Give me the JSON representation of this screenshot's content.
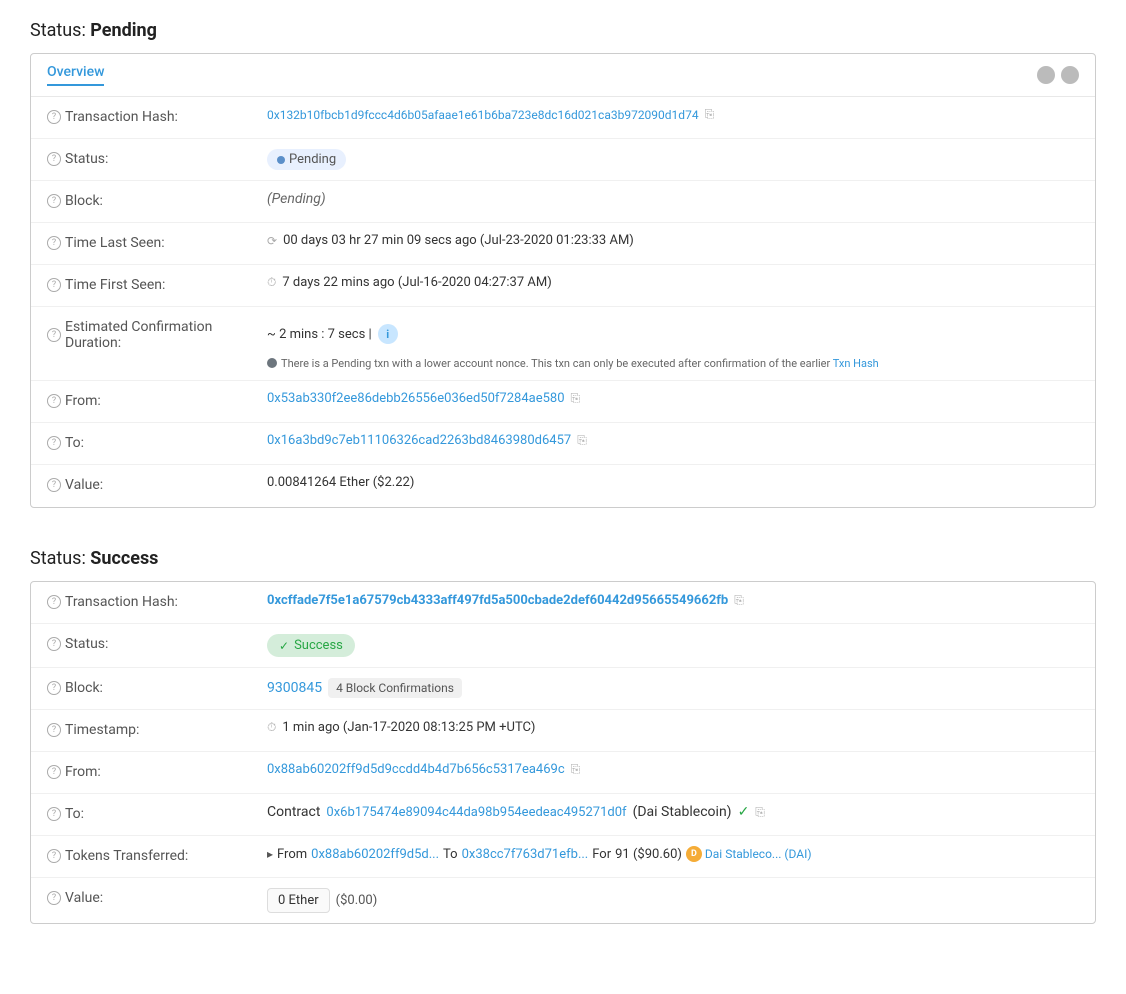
{
  "pending": {
    "section_title": "Status:",
    "section_bold": "Pending",
    "tab_label": "Overview",
    "rows": {
      "transaction_hash_label": "Transaction Hash:",
      "transaction_hash_value": "0x132b10fbcb1d9fccc4d6b05afaae1e61b6ba723e8dc16d021ca3b972090d1d74",
      "status_label": "Status:",
      "status_value": "Pending",
      "block_label": "Block:",
      "block_value": "(Pending)",
      "time_last_seen_label": "Time Last Seen:",
      "time_last_seen_value": "00 days 03 hr 27 min 09 secs ago (Jul-23-2020 01:23:33 AM)",
      "time_first_seen_label": "Time First Seen:",
      "time_first_seen_value": "7 days 22 mins ago (Jul-16-2020 04:27:37 AM)",
      "est_conf_label": "Estimated Confirmation Duration:",
      "est_conf_value": "~ 2 mins : 7 secs |",
      "est_conf_note": "There is a Pending txn with a lower account nonce. This txn can only be executed after confirmation of the earlier Txn Hash",
      "from_label": "From:",
      "from_value": "0x53ab330f2ee86debb26556e036ed50f7284ae580",
      "to_label": "To:",
      "to_value": "0x16a3bd9c7eb11106326cad2263bd8463980d6457",
      "value_label": "Value:",
      "value_value": "0.00841264 Ether ($2.22)"
    }
  },
  "success": {
    "section_title": "Status:",
    "section_bold": "Success",
    "rows": {
      "transaction_hash_label": "Transaction Hash:",
      "transaction_hash_value": "0xcffade7f5e1a67579cb4333aff497fd5a500cbade2def60442d95665549662fb",
      "status_label": "Status:",
      "status_value": "Success",
      "block_label": "Block:",
      "block_number": "9300845",
      "block_confirmations": "4 Block Confirmations",
      "timestamp_label": "Timestamp:",
      "timestamp_value": "1 min ago (Jan-17-2020 08:13:25 PM +UTC)",
      "from_label": "From:",
      "from_value": "0x88ab60202ff9d5d9ccdd4b4d7b656c5317ea469c",
      "to_label": "To:",
      "to_prefix": "Contract",
      "to_contract": "0x6b175474e89094c44da98b954eedeac495271d0f",
      "to_name": "(Dai Stablecoin)",
      "tokens_label": "Tokens Transferred:",
      "tokens_from_label": "From",
      "tokens_from": "0x88ab60202ff9d5d...",
      "tokens_to_label": "To",
      "tokens_to": "0x38cc7f763d71efb...",
      "tokens_for_label": "For",
      "tokens_amount": "91 ($90.60)",
      "tokens_dai": "Dai Stableco... (DAI)",
      "value_label": "Value:",
      "value_ether": "0 Ether",
      "value_usd": "($0.00)"
    }
  },
  "icons": {
    "help": "?",
    "copy": "⎘",
    "clock": "⏱",
    "spinner": "⟳",
    "check": "✓"
  }
}
